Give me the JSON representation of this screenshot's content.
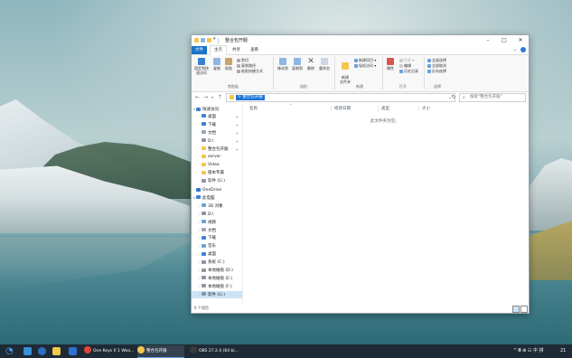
{
  "window": {
    "title": "整合包开服",
    "quick_access_glyph": "▾"
  },
  "tabs": [
    "文件",
    "主页",
    "共享",
    "查看"
  ],
  "ribbon": {
    "clipboard": {
      "pin": "固定到快速访问",
      "copy": "复制",
      "paste": "粘贴",
      "cut": "剪切",
      "copy_path": "复制路径",
      "paste_shortcut": "粘贴快捷方式",
      "label": "剪贴板"
    },
    "organize": {
      "move_to": "移动到",
      "copy_to": "复制到",
      "delete": "删除",
      "rename": "重命名",
      "label": "组织"
    },
    "new": {
      "new_folder": "新建\n文件夹",
      "new_item": "新建项目 ▾",
      "easy_access": "轻松访问 ▾",
      "label": "新建"
    },
    "open": {
      "properties": "属性",
      "open": "打开 ▾",
      "edit": "编辑",
      "history": "历史记录",
      "label": "打开"
    },
    "select": {
      "select_all": "全部选择",
      "select_none": "全部取消",
      "invert": "反向选择",
      "label": "选择"
    }
  },
  "navigation": {
    "back": "←",
    "forward": "→",
    "recent": "▾",
    "up": "↑",
    "address_path": "> 整合包开服",
    "dropdown": "⌄",
    "refresh": "↻",
    "search_placeholder": "搜索\"整合包开服\"",
    "search_glyph": "⌕"
  },
  "nav_pane": {
    "items": [
      {
        "label": "快速访问",
        "icon": "star-icon",
        "indent": 0,
        "chev": "▾"
      },
      {
        "label": "桌面",
        "icon": "desktop-icon",
        "indent": 1,
        "pin": "✦"
      },
      {
        "label": "下载",
        "icon": "download-icon",
        "indent": 1,
        "pin": "✦"
      },
      {
        "label": "文档",
        "icon": "document-icon",
        "indent": 1,
        "pin": "✦"
      },
      {
        "label": "D:\\",
        "icon": "drive-icon",
        "indent": 1,
        "pin": "✦"
      },
      {
        "label": "整合包开服",
        "icon": "folder-icon",
        "indent": 1,
        "pin": "✦"
      },
      {
        "label": "server",
        "icon": "folder-icon",
        "indent": 1
      },
      {
        "label": "Video",
        "icon": "folder-icon",
        "indent": 1
      },
      {
        "label": "版本专属",
        "icon": "folder-icon",
        "indent": 1
      },
      {
        "label": "软件 (G:)",
        "icon": "drive-icon",
        "indent": 1
      },
      {
        "label": "OneDrive",
        "icon": "cloud-icon",
        "indent": 0,
        "chev": "›"
      },
      {
        "label": "此电脑",
        "icon": "computer-icon",
        "indent": 0,
        "chev": "▾"
      },
      {
        "label": "3D 对象",
        "icon": "3d-objects-icon",
        "indent": 1,
        "chev": "›"
      },
      {
        "label": "D:\\",
        "icon": "drive-icon",
        "indent": 1,
        "chev": "›"
      },
      {
        "label": "视频",
        "icon": "video-icon",
        "indent": 1,
        "chev": "›"
      },
      {
        "label": "文档",
        "icon": "document-icon",
        "indent": 1,
        "chev": "›"
      },
      {
        "label": "下载",
        "icon": "download-icon",
        "indent": 1,
        "chev": "›"
      },
      {
        "label": "音乐",
        "icon": "music-icon",
        "indent": 1,
        "chev": "›"
      },
      {
        "label": "桌面",
        "icon": "desktop-icon",
        "indent": 1,
        "chev": "›"
      },
      {
        "label": "系统 (C:)",
        "icon": "drive-icon",
        "indent": 1,
        "chev": "›"
      },
      {
        "label": "本地磁盘 (D:)",
        "icon": "drive-icon",
        "indent": 1,
        "chev": "›"
      },
      {
        "label": "本地磁盘 (E:)",
        "icon": "drive-icon",
        "indent": 1,
        "chev": "›"
      },
      {
        "label": "本地磁盘 (F:)",
        "icon": "drive-icon",
        "indent": 1,
        "chev": "›"
      },
      {
        "label": "软件 (G:)",
        "icon": "drive-icon",
        "indent": 1,
        "chev": "›",
        "selected": true
      }
    ]
  },
  "content": {
    "columns": [
      "名称",
      "修改日期",
      "类型",
      "大小"
    ],
    "sort_glyph": "^",
    "empty_message": "此文件夹为空。"
  },
  "status": {
    "item_count": "0 个项目"
  },
  "taskbar": {
    "apps": [
      {
        "label": "One Keys X 1 Wea...",
        "icon_color": "#e0453a",
        "active": false
      },
      {
        "label": "整合包开服",
        "icon_color": "#f3c64e",
        "active": true
      },
      {
        "label": "OBS 27.2.4 (64 bi...",
        "icon_color": "#3b3b3b",
        "active": false
      }
    ],
    "tray_text": "^ 𝄡 ⊕ ☷ 中 拼",
    "clock": "21"
  },
  "colors": {
    "accent": "#1a73c9",
    "folder": "#f3c64e",
    "taskbar": "#1e2a35"
  }
}
